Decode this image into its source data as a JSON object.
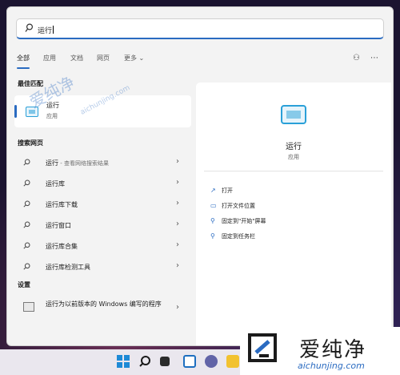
{
  "search": {
    "value": "运行"
  },
  "tabs": [
    {
      "label": "全部",
      "active": true
    },
    {
      "label": "应用"
    },
    {
      "label": "文档"
    },
    {
      "label": "网页"
    },
    {
      "label": "更多"
    }
  ],
  "best_match": {
    "header": "最佳匹配",
    "item": {
      "name": "运行",
      "type": "应用"
    }
  },
  "web_search": {
    "header": "搜索网页",
    "items": [
      {
        "label": "运行",
        "suffix": " - 查看网络搜索结果"
      },
      {
        "label": "运行库"
      },
      {
        "label": "运行库下载"
      },
      {
        "label": "运行窗口"
      },
      {
        "label": "运行库合集"
      },
      {
        "label": "运行库检测工具"
      }
    ]
  },
  "settings": {
    "header": "设置",
    "item": "运行为以前版本的 Windows 编写的程序"
  },
  "detail": {
    "title": "运行",
    "subtitle": "应用",
    "actions": [
      "打开",
      "打开文件位置",
      "固定到\"开始\"屏幕",
      "固定到任务栏"
    ]
  },
  "watermark": {
    "cn": "爱纯净",
    "en": "aichunjing.com"
  },
  "colors": {
    "accent": "#2a6bc1",
    "app_icon": "#2aa0d8"
  }
}
